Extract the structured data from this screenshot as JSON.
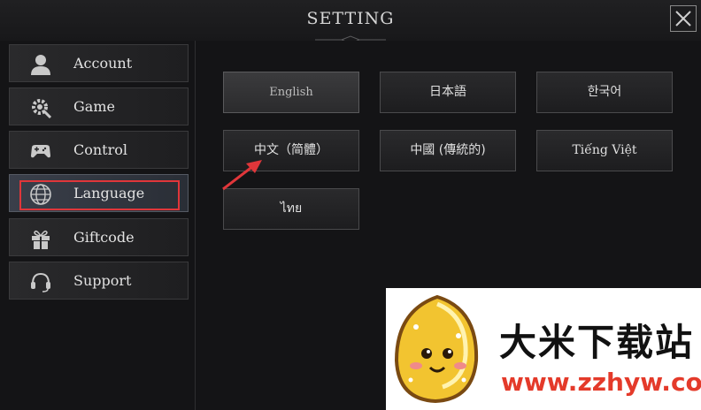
{
  "window": {
    "title": "SETTING",
    "close_icon": "close-icon"
  },
  "sidebar": {
    "items": [
      {
        "label": "Account",
        "icon": "user-icon",
        "active": false
      },
      {
        "label": "Game",
        "icon": "gear-icon",
        "active": false
      },
      {
        "label": "Control",
        "icon": "gamepad-icon",
        "active": false
      },
      {
        "label": "Language",
        "icon": "globe-icon",
        "active": true
      },
      {
        "label": "Giftcode",
        "icon": "gift-icon",
        "active": false
      },
      {
        "label": "Support",
        "icon": "headset-icon",
        "active": false
      }
    ]
  },
  "languages": {
    "options": [
      {
        "label": "English",
        "selected": true
      },
      {
        "label": "日本語",
        "selected": false
      },
      {
        "label": "한국어",
        "selected": false
      },
      {
        "label": "中文（简體）",
        "selected": false
      },
      {
        "label": "中國 (傳統的)",
        "selected": false
      },
      {
        "label": "Tiếng Việt",
        "selected": false
      },
      {
        "label": "ไทย",
        "selected": false
      }
    ]
  },
  "annotation": {
    "highlight_color": "#e0363a",
    "arrow_color": "#e0363a"
  },
  "watermark": {
    "name": "大米下载站",
    "url": "www.zzhyw.com"
  }
}
